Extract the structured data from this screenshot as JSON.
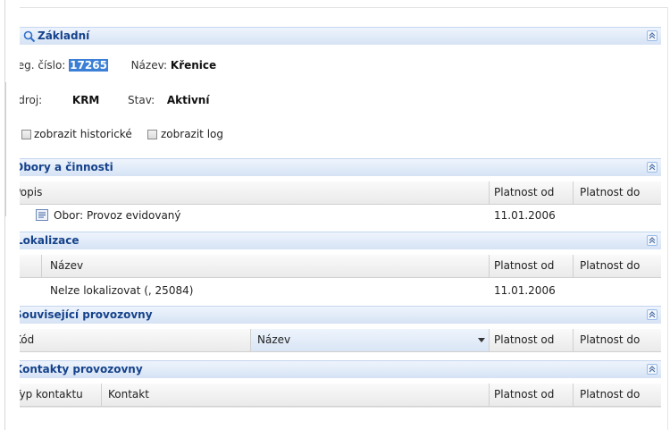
{
  "basic": {
    "title": "Základní",
    "reg_label": "Reg. číslo:",
    "reg_value": "17265",
    "name_label": "Název:",
    "name_value": "Křenice",
    "source_label": "Zdroj:",
    "source_value": "KRM",
    "state_label": "Stav:",
    "state_value": "Aktivní",
    "show_history_label": "zobrazit historické",
    "show_log_label": "zobrazit log"
  },
  "obory": {
    "title": "Obory a činnosti",
    "columns": [
      "Popis",
      "Platnost od",
      "Platnost do"
    ],
    "rows": [
      {
        "popis": "Obor: Provoz evidovaný",
        "od": "11.01.2006",
        "do": ""
      }
    ]
  },
  "lokalizace": {
    "title": "Lokalizace",
    "columns": [
      "Název",
      "Platnost od",
      "Platnost do"
    ],
    "rows": [
      {
        "nazev": "Nelze lokalizovat (, 25084)",
        "od": "11.01.2006",
        "do": ""
      }
    ]
  },
  "souvisejici": {
    "title": "Související provozovny",
    "columns": [
      "Kód",
      "Název",
      "Platnost od",
      "Platnost do"
    ]
  },
  "kontakty": {
    "title": "Kontakty provozovny",
    "columns": [
      "Typ kontaktu",
      "Kontakt",
      "Platnost od",
      "Platnost do"
    ]
  },
  "icons": {
    "search": "search-icon",
    "collapse": "double-chevron-up-icon",
    "row": "list-row-icon",
    "sort": "sort-down-icon"
  },
  "colors": {
    "header_text": "#15428b",
    "selection": "#3b7fd6",
    "header_bg_top": "#eef4fc",
    "header_bg_bottom": "#d6e3f5"
  }
}
